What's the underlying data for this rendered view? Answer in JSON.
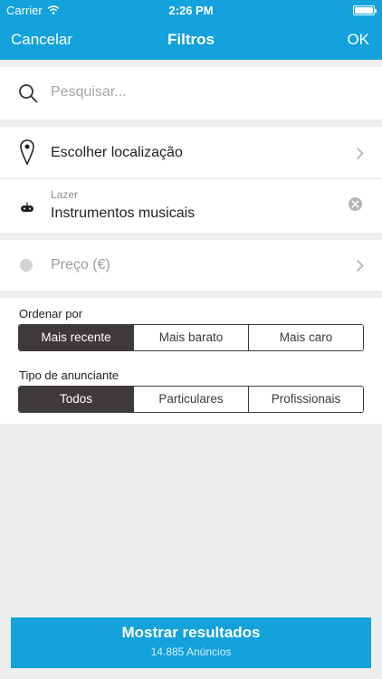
{
  "status_bar": {
    "carrier": "Carrier",
    "time": "2:26 PM"
  },
  "nav": {
    "cancel": "Cancelar",
    "title": "Filtros",
    "ok": "OK"
  },
  "search": {
    "placeholder": "Pesquisar..."
  },
  "location": {
    "label": "Escolher localização"
  },
  "category": {
    "group": "Lazer",
    "value": "Instrumentos musicais"
  },
  "price": {
    "label": "Preço (€)"
  },
  "sort": {
    "label": "Ordenar por",
    "options": [
      "Mais recente",
      "Mais barato",
      "Mais caro"
    ],
    "selected": "Mais recente"
  },
  "advertiser": {
    "label": "Tipo de anunciante",
    "options": [
      "Todos",
      "Particulares",
      "Profissionais"
    ],
    "selected": "Todos"
  },
  "results_button": {
    "label": "Mostrar resultados",
    "count": "14.885 Anúncios"
  },
  "colors": {
    "accent": "#13a2db",
    "segment_selected": "#3f3a3a",
    "background": "#eeeeee"
  },
  "icons": [
    "wifi-icon",
    "battery-icon",
    "search-icon",
    "location-pin-icon",
    "chevron-right-icon",
    "gamepad-icon",
    "clear-icon"
  ]
}
